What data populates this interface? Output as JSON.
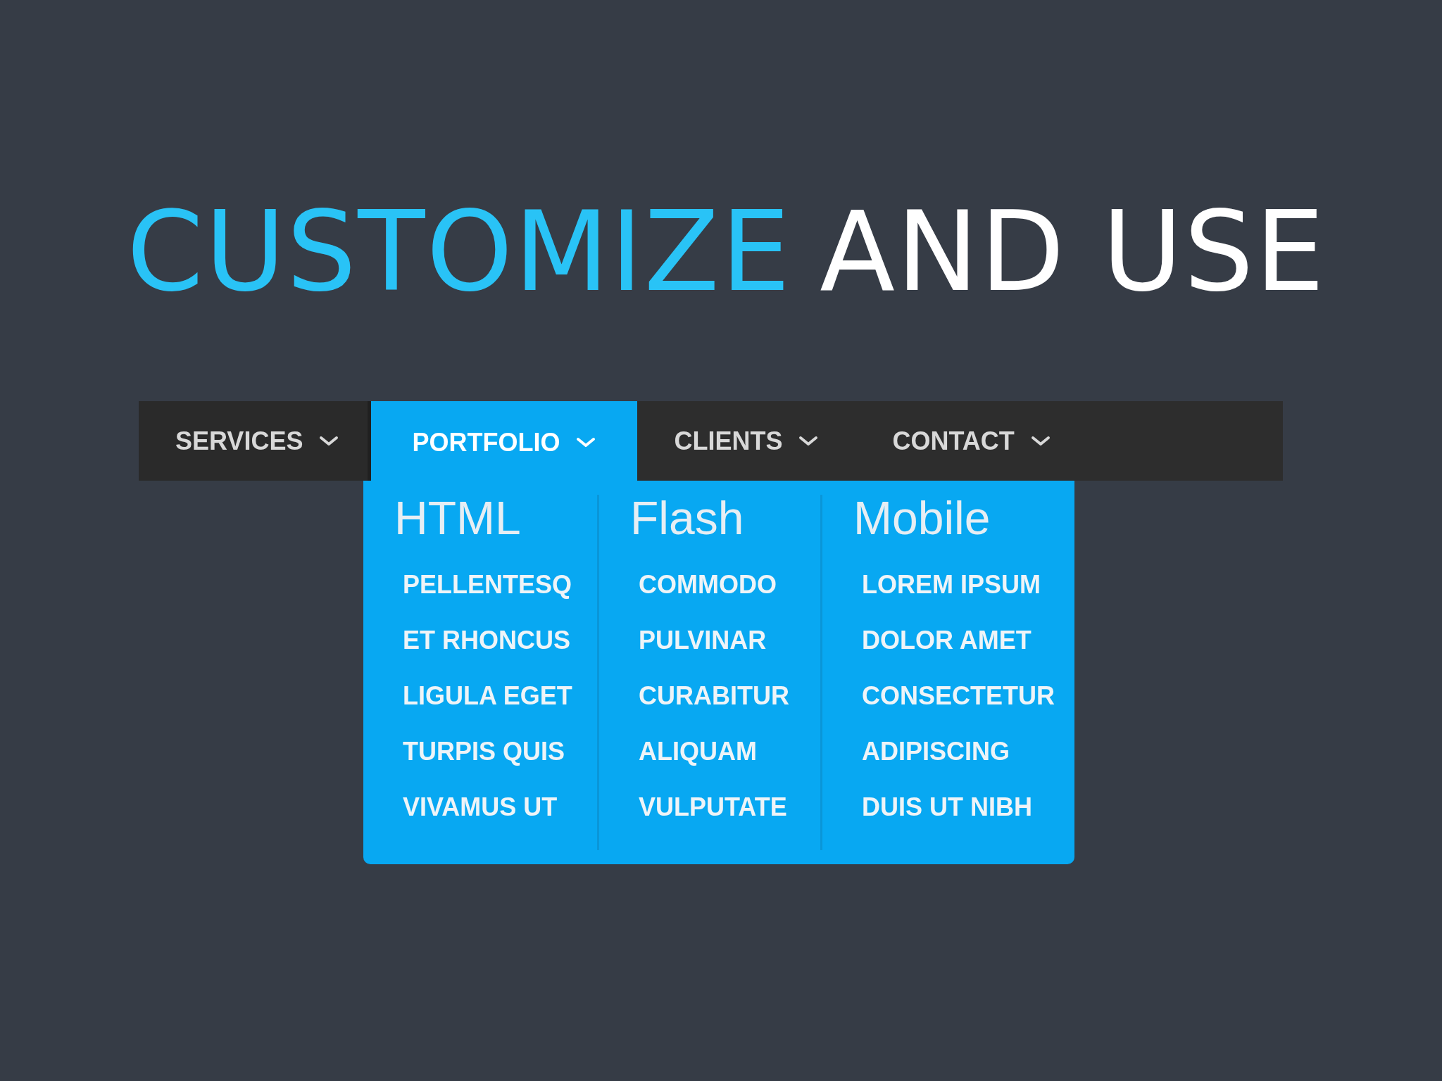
{
  "headline": [
    {
      "text": "CUSTOMIZE",
      "kind": "accent"
    },
    {
      "text": "AND USE",
      "kind": "plain"
    }
  ],
  "nav": {
    "items": [
      {
        "label": "SERVICES",
        "selected": false
      },
      {
        "label": "PORTFOLIO",
        "selected": true
      },
      {
        "label": "CLIENTS",
        "selected": false
      },
      {
        "label": "CONTACT",
        "selected": false
      }
    ]
  },
  "dropdown": {
    "columns": [
      {
        "heading": "HTML",
        "items": [
          "PELLENTESQ",
          "ET RHONCUS",
          "LIGULA EGET",
          "TURPIS QUIS",
          "VIVAMUS UT"
        ]
      },
      {
        "heading": "Flash",
        "items": [
          "COMMODO",
          "PULVINAR",
          "CURABITUR",
          "ALIQUAM",
          "VULPUTATE"
        ]
      },
      {
        "heading": "Mobile",
        "items": [
          "LOREM IPSUM",
          "DOLOR AMET",
          "CONSECTETUR",
          "ADIPISCING",
          "DUIS UT NIBH"
        ]
      }
    ]
  }
}
